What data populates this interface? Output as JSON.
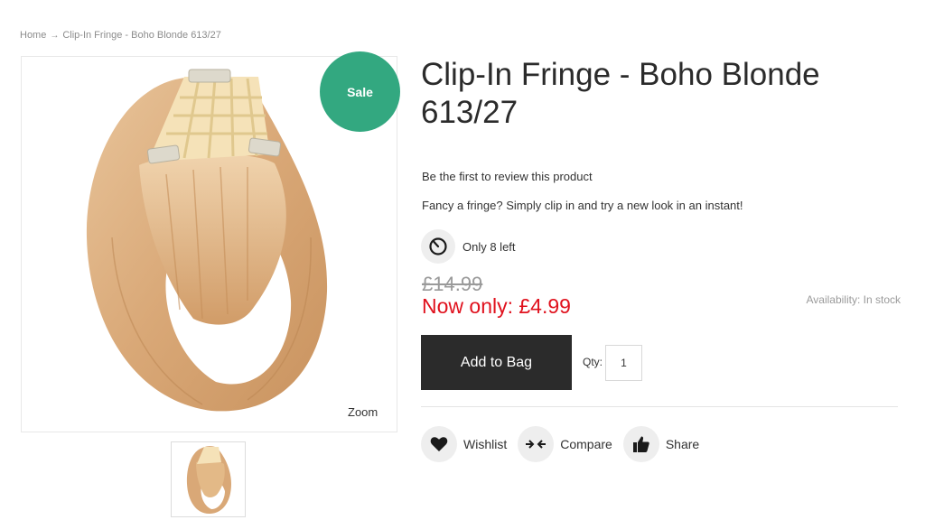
{
  "breadcrumb": {
    "home": "Home",
    "separator": "→",
    "current": "Clip-In Fringe - Boho Blonde 613/27"
  },
  "gallery": {
    "sale_badge": "Sale",
    "zoom_label": "Zoom",
    "image_subject": "blonde clip-in fringe hairpiece"
  },
  "product": {
    "title": "Clip-In Fringe - Boho Blonde 613/27",
    "review_link": "Be the first to review this product",
    "description": "Fancy a fringe? Simply clip in and try a new look in an instant!",
    "stock_note": "Only 8 left",
    "old_price": "£14.99",
    "now_price": "Now only: £4.99",
    "availability": "Availability: In stock"
  },
  "cart": {
    "add_label": "Add to Bag",
    "qty_label": "Qty:",
    "qty_value": "1"
  },
  "actions": {
    "wishlist": "Wishlist",
    "compare": "Compare",
    "share": "Share"
  },
  "icons": {
    "stock": "timer-icon",
    "wishlist": "heart-icon",
    "compare": "compare-arrows-icon",
    "share": "thumbs-up-icon"
  },
  "colors": {
    "sale_badge": "#33a880",
    "now_price": "#e0111d",
    "button": "#2b2b2b",
    "old_price": "#9a9a9a"
  }
}
